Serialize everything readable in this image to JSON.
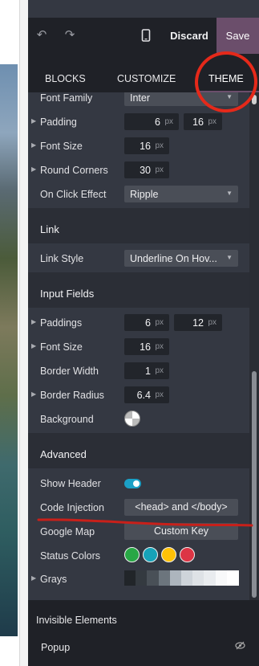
{
  "toolbar": {
    "discard_label": "Discard",
    "save_label": "Save",
    "undo_icon": "undo-icon",
    "redo_icon": "redo-icon",
    "mobile_icon": "mobile-preview-icon"
  },
  "tabs": [
    {
      "label": "BLOCKS"
    },
    {
      "label": "CUSTOMIZE"
    },
    {
      "label": "THEME",
      "active": true
    }
  ],
  "buttons_section": {
    "font_family": {
      "label": "Font Family",
      "value": "Inter"
    },
    "padding": {
      "label": "Padding",
      "v1": "6",
      "v2": "16",
      "unit": "px"
    },
    "font_size": {
      "label": "Font Size",
      "value": "16",
      "unit": "px"
    },
    "round_corners": {
      "label": "Round Corners",
      "value": "30",
      "unit": "px"
    },
    "on_click": {
      "label": "On Click Effect",
      "value": "Ripple"
    }
  },
  "link_section": {
    "title": "Link",
    "style": {
      "label": "Link Style",
      "value": "Underline On Hov..."
    }
  },
  "input_section": {
    "title": "Input Fields",
    "paddings": {
      "label": "Paddings",
      "v1": "6",
      "v2": "12",
      "unit": "px"
    },
    "font_size": {
      "label": "Font Size",
      "value": "16",
      "unit": "px"
    },
    "border_width": {
      "label": "Border Width",
      "value": "1",
      "unit": "px"
    },
    "border_radius": {
      "label": "Border Radius",
      "value": "6.4",
      "unit": "px"
    },
    "background": {
      "label": "Background"
    }
  },
  "advanced_section": {
    "title": "Advanced",
    "show_header": {
      "label": "Show Header",
      "enabled": true
    },
    "code_injection": {
      "label": "Code Injection",
      "button": "<head> and </body>"
    },
    "google_map": {
      "label": "Google Map",
      "button": "Custom Key"
    },
    "status_colors": {
      "label": "Status Colors",
      "colors": [
        "#28a745",
        "#17a2b8",
        "#ffc107",
        "#dc3545"
      ]
    },
    "grays": {
      "label": "Grays",
      "colors": [
        "#212529",
        "#343a40",
        "#495057",
        "#6c757d",
        "#adb5bd",
        "#ced4da",
        "#dee2e6",
        "#e9ecef",
        "#f8f9fa",
        "#ffffff"
      ]
    }
  },
  "bottom": {
    "invisible_elements": "Invisible Elements",
    "popup": "Popup",
    "popup_icon": "eye-slash-icon"
  },
  "colors": {
    "accent": "#6b4e6b",
    "panel": "#343842",
    "dark": "#1f2127",
    "annotation": "#e5291a",
    "toggle": "#1ba0c6"
  }
}
